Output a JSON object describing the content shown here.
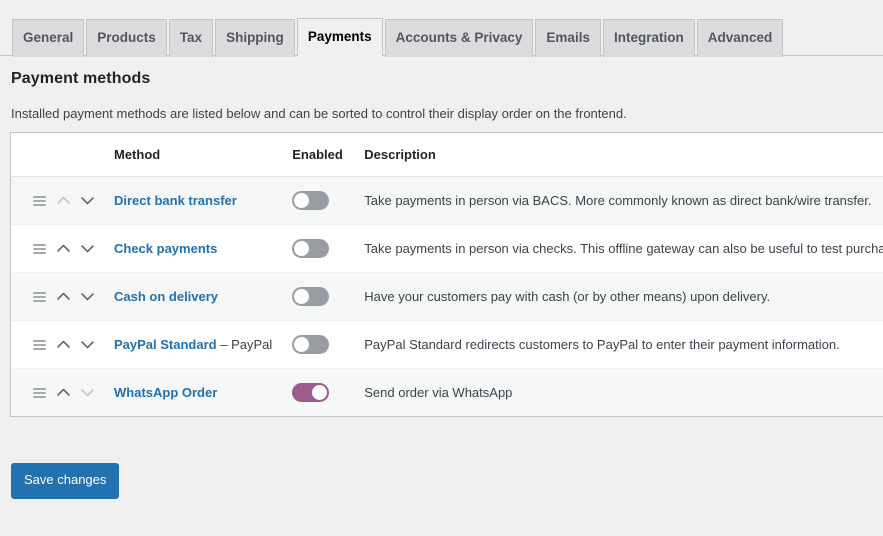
{
  "tabs": [
    {
      "label": "General",
      "active": false
    },
    {
      "label": "Products",
      "active": false
    },
    {
      "label": "Tax",
      "active": false
    },
    {
      "label": "Shipping",
      "active": false
    },
    {
      "label": "Payments",
      "active": true
    },
    {
      "label": "Accounts & Privacy",
      "active": false
    },
    {
      "label": "Emails",
      "active": false
    },
    {
      "label": "Integration",
      "active": false
    },
    {
      "label": "Advanced",
      "active": false
    }
  ],
  "heading": "Payment methods",
  "description": "Installed payment methods are listed below and can be sorted to control their display order on the frontend.",
  "table": {
    "columns": {
      "sort": "",
      "method": "Method",
      "enabled": "Enabled",
      "description": "Description"
    },
    "rows": [
      {
        "name": "Direct bank transfer",
        "suffix": "",
        "enabled": false,
        "up_disabled": true,
        "down_disabled": false,
        "description": "Take payments in person via BACS. More commonly known as direct bank/wire transfer."
      },
      {
        "name": "Check payments",
        "suffix": "",
        "enabled": false,
        "up_disabled": false,
        "down_disabled": false,
        "description": "Take payments in person via checks. This offline gateway can also be useful to test purchases."
      },
      {
        "name": "Cash on delivery",
        "suffix": "",
        "enabled": false,
        "up_disabled": false,
        "down_disabled": false,
        "description": "Have your customers pay with cash (or by other means) upon delivery."
      },
      {
        "name": "PayPal Standard",
        "suffix": " – PayPal",
        "enabled": false,
        "up_disabled": false,
        "down_disabled": false,
        "description": "PayPal Standard redirects customers to PayPal to enter their payment information."
      },
      {
        "name": "WhatsApp Order",
        "suffix": "",
        "enabled": true,
        "up_disabled": false,
        "down_disabled": true,
        "description": "Send order via WhatsApp"
      }
    ]
  },
  "save_button": "Save changes",
  "colors": {
    "link": "#2271b1",
    "primary_button": "#2271b1",
    "toggle_on": "#9b5c8f",
    "toggle_off": "#999da1",
    "page_background": "#f0f0f1",
    "row_stripe": "#f6f7f7"
  }
}
